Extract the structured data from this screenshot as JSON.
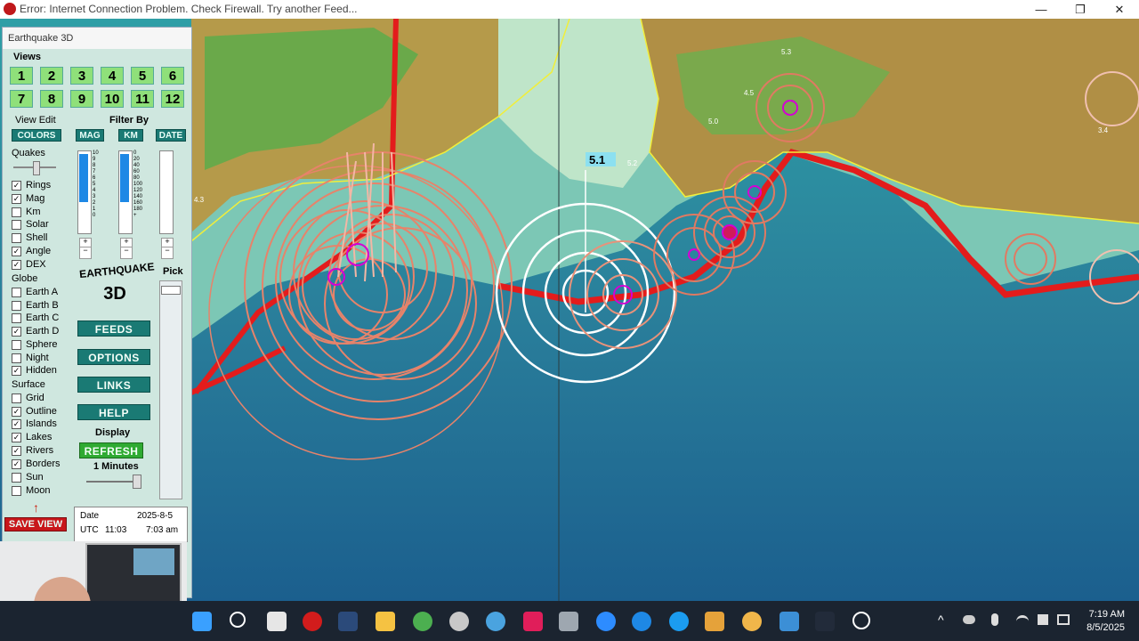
{
  "window": {
    "title": "Error: Internet Connection Problem. Check Firewall. Try another Feed...",
    "minimize": "—",
    "maximize": "❐",
    "close": "✕"
  },
  "panel": {
    "title": "Earthquake 3D",
    "views_label": "Views",
    "views": [
      "1",
      "2",
      "3",
      "4",
      "5",
      "6",
      "7",
      "8",
      "9",
      "10",
      "11",
      "12"
    ],
    "view_edit_label": "View Edit",
    "colors_button": "COLORS",
    "filter_by_label": "Filter By",
    "filter_buttons": [
      "MAG",
      "KM",
      "DATE"
    ],
    "quakes_label": "Quakes",
    "options_top": [
      {
        "label": "Rings",
        "checked": true
      },
      {
        "label": "Mag",
        "checked": true
      },
      {
        "label": "Km",
        "checked": false
      },
      {
        "label": "Solar",
        "checked": false
      },
      {
        "label": "Shell",
        "checked": false
      },
      {
        "label": "Angle",
        "checked": true
      },
      {
        "label": "DEX",
        "checked": true
      }
    ],
    "globe_label": "Globe",
    "globe_options": [
      {
        "label": "Earth A",
        "checked": false
      },
      {
        "label": "Earth B",
        "checked": false
      },
      {
        "label": "Earth C",
        "checked": false
      },
      {
        "label": "Earth D",
        "checked": true
      },
      {
        "label": "Sphere",
        "checked": false
      },
      {
        "label": "Night",
        "checked": false
      },
      {
        "label": "Hidden",
        "checked": true
      }
    ],
    "surface_label": "Surface",
    "surface_options": [
      {
        "label": "Grid",
        "checked": false
      },
      {
        "label": "Outline",
        "checked": true
      },
      {
        "label": "Islands",
        "checked": true
      },
      {
        "label": "Lakes",
        "checked": true
      },
      {
        "label": "Rivers",
        "checked": true
      },
      {
        "label": "Borders",
        "checked": true
      },
      {
        "label": "Sun",
        "checked": false
      },
      {
        "label": "Moon",
        "checked": false
      }
    ],
    "mag_ticks": [
      "10",
      "9",
      "8",
      "7",
      "6",
      "5",
      "4",
      "3",
      "2",
      "1",
      "0"
    ],
    "km_ticks": [
      "0",
      "20",
      "40",
      "60",
      "80",
      "100",
      "120",
      "140",
      "160",
      "180",
      "+"
    ],
    "plus": "+",
    "minus": "−",
    "logo_line1": "EARTHQUAKE",
    "logo_line2": "3D",
    "pick_label": "Pick",
    "feeds_button": "FEEDS",
    "options_button": "OPTIONS",
    "links_button": "LINKS",
    "help_button": "HELP",
    "display_label": "Display",
    "refresh_button": "REFRESH",
    "refresh_interval": "1 Minutes",
    "save_view_button": "SAVE VIEW",
    "date_label": "Date",
    "date_value": "2025-8-5",
    "utc_label": "UTC",
    "utc_value": "11:03",
    "local_value": "7:03 am"
  },
  "map": {
    "highlight_label": "5.1",
    "labels": [
      "5.3",
      "5.0",
      "5.2",
      "3.4",
      "4.5",
      "4.3"
    ]
  },
  "taskbar": {
    "time": "7:19 AM",
    "date": "8/5/2025",
    "tray_arrow": "^"
  }
}
